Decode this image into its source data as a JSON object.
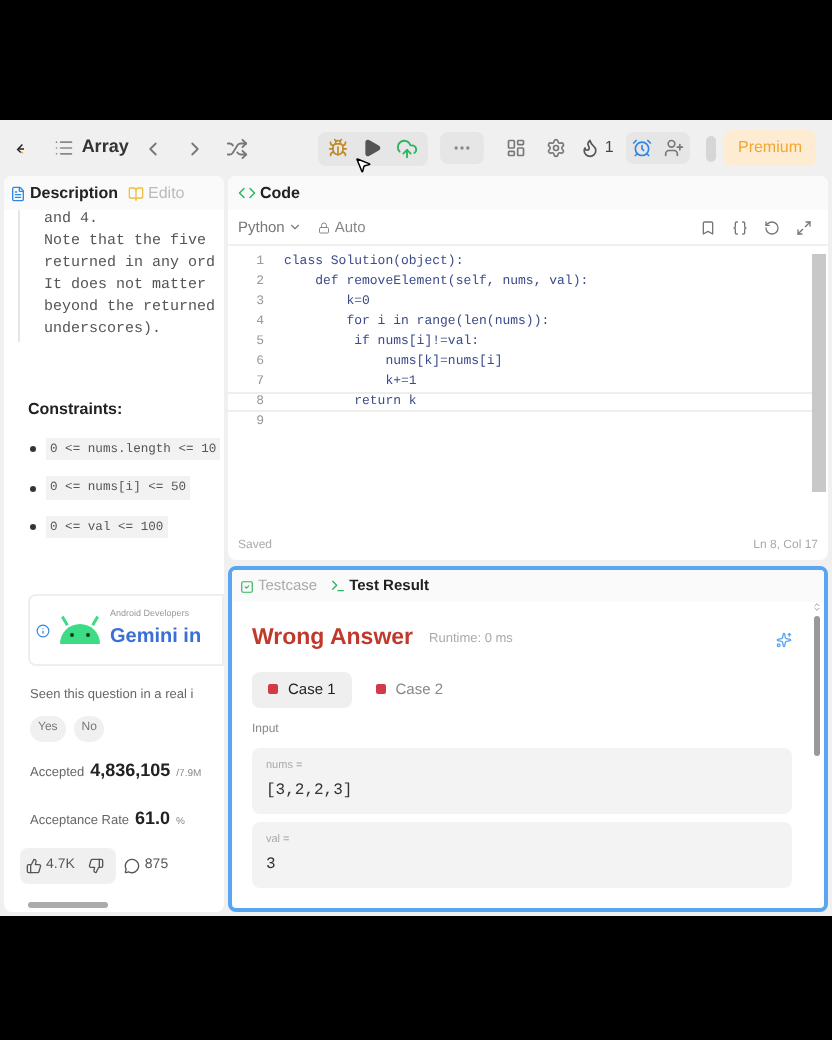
{
  "toolbar": {
    "problem_list": "Array",
    "streak": "1",
    "premium": "Premium"
  },
  "left_tabs": [
    {
      "label": "Description",
      "selected": true
    },
    {
      "label": "Edito",
      "selected": false
    }
  ],
  "description_lines": [
    "and 4.",
    "Note that the five",
    "returned in any ord",
    "It does not matter",
    "beyond the returned",
    "underscores)."
  ],
  "constraints": {
    "title": "Constraints:",
    "items": [
      "0 <= nums.length <= 10",
      "0 <= nums[i] <= 50",
      "0 <= val <= 100"
    ]
  },
  "ad": {
    "source": "Android Developers",
    "title": "Gemini in"
  },
  "feedback": {
    "question": "Seen this question in a real i",
    "options": [
      "Yes",
      "No"
    ]
  },
  "stats": [
    {
      "label": "Accepted",
      "value": "4,836,105",
      "suffix": "/7.9M"
    },
    {
      "label": "Acceptance Rate",
      "value": "61.0",
      "suffix": "%"
    }
  ],
  "reactions": {
    "likes": "4.7K",
    "comments": "875"
  },
  "code_panel": {
    "title": "Code",
    "language": "Python",
    "mode": "Auto",
    "status": "Saved",
    "cursor": "Ln 8, Col 17",
    "lines": [
      {
        "number": "1",
        "text": "class Solution(object):",
        "current": false
      },
      {
        "number": "2",
        "text": "    def removeElement(self, nums, val):",
        "current": false
      },
      {
        "number": "3",
        "text": "        k=0",
        "current": false
      },
      {
        "number": "4",
        "text": "        for i in range(len(nums)):",
        "current": false
      },
      {
        "number": "5",
        "text": "         if nums[i]!=val:",
        "current": false
      },
      {
        "number": "6",
        "text": "             nums[k]=nums[i]",
        "current": false
      },
      {
        "number": "7",
        "text": "             k+=1",
        "current": false
      },
      {
        "number": "8",
        "text": "         return k",
        "current": true
      },
      {
        "number": "9",
        "current": false
      }
    ]
  },
  "result_panel": {
    "tabs": [
      {
        "label": "Testcase",
        "selected": false
      },
      {
        "label": "Test Result",
        "selected": true
      }
    ],
    "verdict": "Wrong Answer",
    "runtime": "Runtime: 0 ms",
    "cases": [
      {
        "label": "Case 1",
        "selected": true
      },
      {
        "label": "Case 2",
        "selected": false
      }
    ],
    "input_label": "Input",
    "inputs": [
      {
        "name": "nums =",
        "value": "[3,2,2,3]"
      },
      {
        "name": "val =",
        "value": "3"
      }
    ]
  }
}
